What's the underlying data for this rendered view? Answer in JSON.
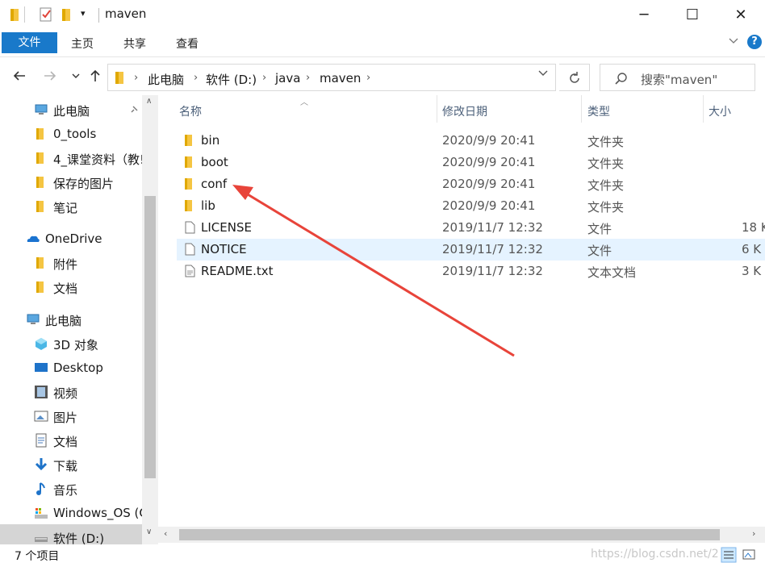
{
  "window": {
    "title": "maven",
    "controls": {
      "minimize": "─",
      "maximize": "☐",
      "close": "✕"
    }
  },
  "ribbon": {
    "file_tab": "文件",
    "tabs": [
      "主页",
      "共享",
      "查看"
    ],
    "help": "?"
  },
  "address": {
    "breadcrumbs": [
      "此电脑",
      "软件 (D:)",
      "java",
      "maven"
    ],
    "search_placeholder": "搜索\"maven\""
  },
  "nav": {
    "items": [
      {
        "label": "此电脑",
        "icon": "pc-icon",
        "pinned": true
      },
      {
        "label": "0_tools",
        "icon": "folder-icon"
      },
      {
        "label": "4_课堂资料（教!",
        "icon": "folder-icon"
      },
      {
        "label": "保存的图片",
        "icon": "folder-icon"
      },
      {
        "label": "笔记",
        "icon": "folder-icon"
      },
      {
        "label": "OneDrive",
        "icon": "onedrive-icon"
      },
      {
        "label": "附件",
        "icon": "folder-icon"
      },
      {
        "label": "文档",
        "icon": "folder-icon"
      },
      {
        "label": "此电脑",
        "icon": "pc-icon"
      },
      {
        "label": "3D 对象",
        "icon": "3d-objects-icon"
      },
      {
        "label": "Desktop",
        "icon": "desktop-icon"
      },
      {
        "label": "视频",
        "icon": "video-icon"
      },
      {
        "label": "图片",
        "icon": "pictures-icon"
      },
      {
        "label": "文档",
        "icon": "documents-icon"
      },
      {
        "label": "下载",
        "icon": "download-icon"
      },
      {
        "label": "音乐",
        "icon": "music-icon"
      },
      {
        "label": "Windows_OS (C",
        "icon": "drive-c-icon"
      },
      {
        "label": "软件 (D:)",
        "icon": "drive-d-icon",
        "selected": true
      }
    ]
  },
  "columns": {
    "name": "名称",
    "date": "修改日期",
    "type": "类型",
    "size": "大小"
  },
  "files": [
    {
      "name": "bin",
      "date": "2020/9/9 20:41",
      "type": "文件夹",
      "size": "",
      "kind": "folder"
    },
    {
      "name": "boot",
      "date": "2020/9/9 20:41",
      "type": "文件夹",
      "size": "",
      "kind": "folder"
    },
    {
      "name": "conf",
      "date": "2020/9/9 20:41",
      "type": "文件夹",
      "size": "",
      "kind": "folder"
    },
    {
      "name": "lib",
      "date": "2020/9/9 20:41",
      "type": "文件夹",
      "size": "",
      "kind": "folder"
    },
    {
      "name": "LICENSE",
      "date": "2019/11/7 12:32",
      "type": "文件",
      "size": "18 K",
      "kind": "file"
    },
    {
      "name": "NOTICE",
      "date": "2019/11/7 12:32",
      "type": "文件",
      "size": "6 K",
      "kind": "file",
      "selected": true
    },
    {
      "name": "README.txt",
      "date": "2019/11/7 12:32",
      "type": "文本文档",
      "size": "3 K",
      "kind": "file"
    }
  ],
  "status": {
    "item_count": "7 个项目",
    "watermark": "https://blog.csdn.net/2"
  },
  "colors": {
    "accent": "#1979ca",
    "selection": "#e5f3ff",
    "annotation_arrow": "#e8443a"
  }
}
